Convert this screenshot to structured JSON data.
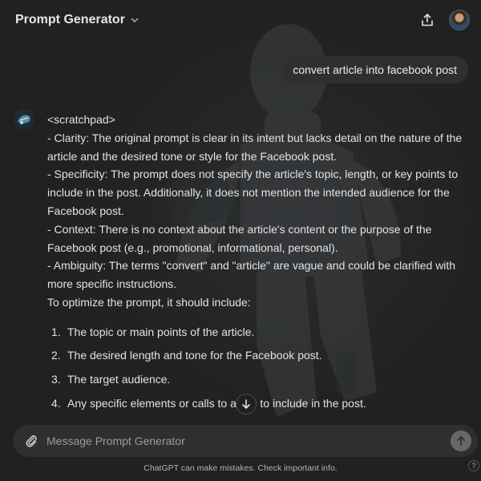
{
  "header": {
    "title": "Prompt Generator",
    "chevron_icon": "chevron-down-icon",
    "share_icon": "share-icon",
    "avatar_icon": "user-avatar"
  },
  "conversation": {
    "user_message": "convert article into facebook post",
    "assistant": {
      "lines": [
        "<scratchpad>",
        "- Clarity: The original prompt is clear in its intent but lacks detail on the nature of the article and the desired tone or style for the Facebook post.",
        "- Specificity: The prompt does not specify the article's topic, length, or key points to include in the post. Additionally, it does not mention the intended audience for the Facebook post.",
        "- Context: There is no context about the article's content or the purpose of the Facebook post (e.g., promotional, informational, personal).",
        "- Ambiguity: The terms \"convert\" and \"article\" are vague and could be clarified with more specific instructions.",
        "To optimize the prompt, it should include:"
      ],
      "list": [
        {
          "num": "1.",
          "text": "The topic or main points of the article."
        },
        {
          "num": "2.",
          "text": "The desired length and tone for the Facebook post."
        },
        {
          "num": "3.",
          "text": "The target audience."
        },
        {
          "num": "4.",
          "text": "Any specific elements or calls to acti    to include in the post."
        }
      ]
    }
  },
  "composer": {
    "placeholder": "Message Prompt Generator",
    "value": "",
    "attach_icon": "paperclip-icon",
    "send_icon": "arrow-up-icon"
  },
  "footer": {
    "disclaimer": "ChatGPT can make mistakes. Check important info.",
    "help_label": "?"
  },
  "colors": {
    "background": "#212121",
    "bubble": "#2f2f2f",
    "text": "#ececec",
    "muted": "#9b9b9b"
  }
}
